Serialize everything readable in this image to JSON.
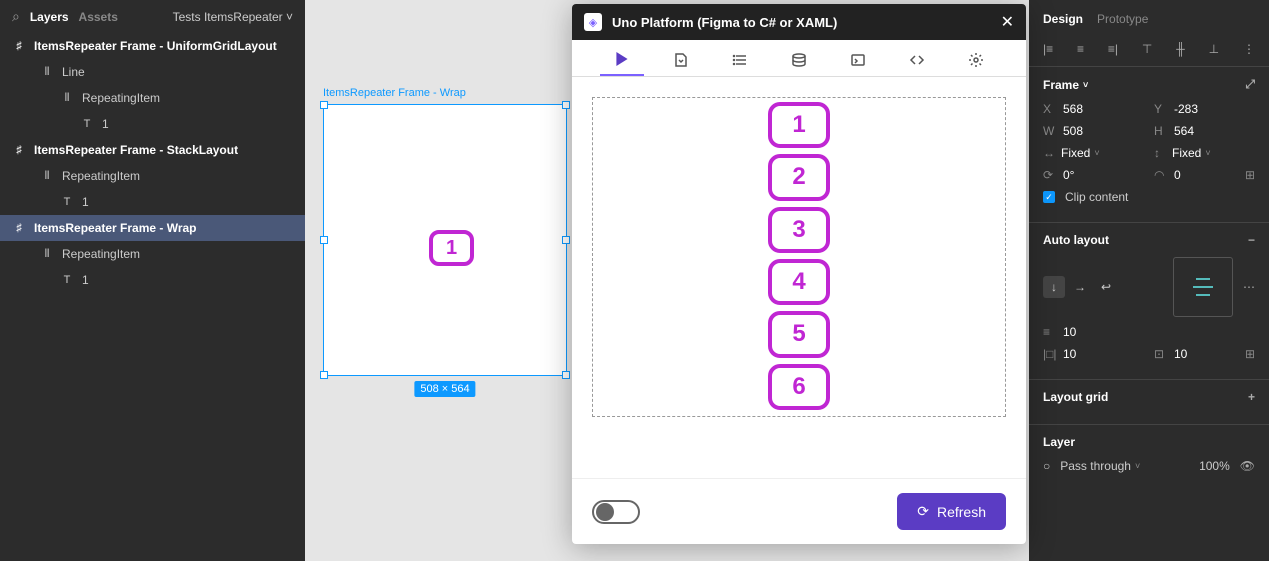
{
  "layers": {
    "tab_layers": "Layers",
    "tab_assets": "Assets",
    "file_name": "Tests ItemsRepeater",
    "tree": [
      {
        "name": "ItemsRepeater Frame - UniformGridLayout",
        "icon": "frame",
        "bold": true,
        "indent": 0
      },
      {
        "name": "Line",
        "icon": "line",
        "indent": 1
      },
      {
        "name": "RepeatingItem",
        "icon": "line",
        "indent": 2
      },
      {
        "name": "1",
        "icon": "text",
        "indent": 3
      },
      {
        "name": "ItemsRepeater Frame - StackLayout",
        "icon": "frame",
        "bold": true,
        "indent": 0
      },
      {
        "name": "RepeatingItem",
        "icon": "line",
        "indent": 1
      },
      {
        "name": "1",
        "icon": "text",
        "indent": 2
      },
      {
        "name": "ItemsRepeater Frame - Wrap",
        "icon": "frame",
        "bold": true,
        "indent": 0,
        "selected": true
      },
      {
        "name": "RepeatingItem",
        "icon": "line",
        "indent": 1
      },
      {
        "name": "1",
        "icon": "text",
        "indent": 2
      }
    ]
  },
  "canvas": {
    "frame_label": "ItemsRepeater Frame - Wrap",
    "dim_badge": "508 × 564",
    "item_number": "1"
  },
  "plugin": {
    "title": "Uno Platform (Figma to C# or XAML)",
    "items": [
      "1",
      "2",
      "3",
      "4",
      "5",
      "6"
    ],
    "refresh": "Refresh"
  },
  "design": {
    "tab_design": "Design",
    "tab_prototype": "Prototype",
    "frame_title": "Frame",
    "x": "568",
    "y": "-283",
    "w": "508",
    "h": "564",
    "constraint_x": "Fixed",
    "constraint_y": "Fixed",
    "rotation": "0°",
    "corner": "0",
    "clip": "Clip content",
    "auto_layout_title": "Auto layout",
    "spacing": "10",
    "padding": "10",
    "padding_v": "10",
    "layout_grid_title": "Layout grid",
    "layer_title": "Layer",
    "blend": "Pass through",
    "opacity": "100%"
  }
}
